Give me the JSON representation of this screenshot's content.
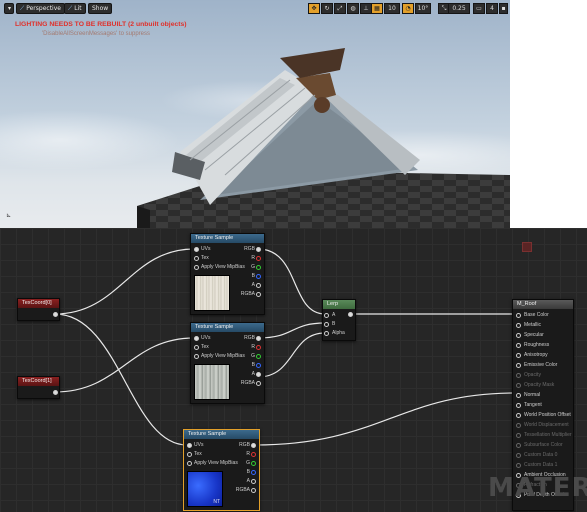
{
  "viewport": {
    "perspective_label": "Perspective",
    "lit_label": "Lit",
    "show_label": "Show",
    "grid_snap": "10",
    "rotation_snap": "10°",
    "scale_snap": "0.25",
    "camera_speed": "4",
    "warning": "LIGHTING NEEDS TO BE REBUILT (2 unbuilt objects)",
    "warning_hint": "'DisableAllScreenMessages' to suppress"
  },
  "nodes": {
    "texture_sample_1": {
      "title": "Texture Sample",
      "inputs": [
        "UVs",
        "Tex",
        "Apply View MipBias"
      ],
      "outputs": [
        "RGB",
        "R",
        "G",
        "B",
        "A",
        "RGBA"
      ]
    },
    "texture_sample_2": {
      "title": "Texture Sample",
      "inputs": [
        "UVs",
        "Tex",
        "Apply View MipBias"
      ],
      "outputs": [
        "RGB",
        "R",
        "G",
        "B",
        "A",
        "RGBA"
      ]
    },
    "texture_sample_3": {
      "title": "Texture Sample",
      "inputs": [
        "UVs",
        "Tex",
        "Apply View MipBias"
      ],
      "outputs": [
        "RGB",
        "R",
        "G",
        "B",
        "A",
        "RGBA"
      ],
      "thumb_label": "NT"
    },
    "texcoord_0": {
      "title": "TexCoord[0]"
    },
    "texcoord_1": {
      "title": "TexCoord[1]"
    },
    "lerp": {
      "title": "Lerp",
      "inputs": [
        "A",
        "B",
        "Alpha"
      ]
    },
    "material": {
      "title": "M_Roof",
      "pins": [
        "Base Color",
        "Metallic",
        "Specular",
        "Roughness",
        "Anisotropy",
        "Emissive Color",
        "Opacity",
        "Opacity Mask",
        "Normal",
        "Tangent",
        "World Position Offset",
        "World Displacement",
        "Tessellation Multiplier",
        "Subsurface Color",
        "Custom Data 0",
        "Custom Data 1",
        "Ambient Occlusion",
        "Refraction",
        "Pixel Depth Offset"
      ],
      "enabled": [
        true,
        true,
        true,
        true,
        true,
        true,
        false,
        false,
        true,
        true,
        true,
        false,
        false,
        false,
        false,
        false,
        true,
        false,
        true
      ]
    }
  },
  "watermark": "MATERI",
  "colors": {
    "accent": "#e3a02a",
    "warning": "#e0302a",
    "tex_header": "#3c6a8d",
    "coord_header": "#8b2020",
    "lerp_header": "#5a8a5a"
  }
}
